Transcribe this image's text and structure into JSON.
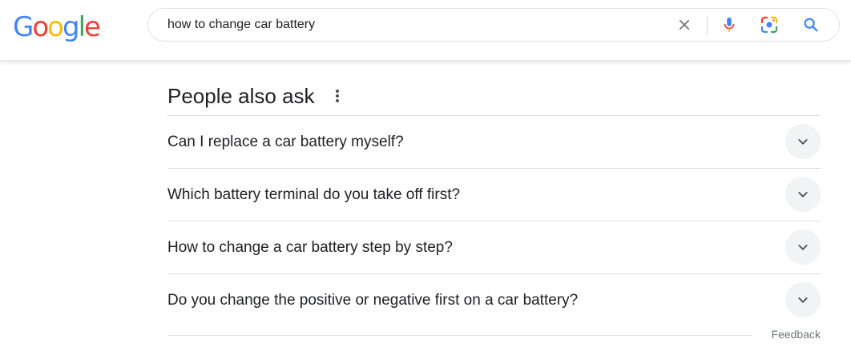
{
  "logo": {
    "letters": [
      "G",
      "o",
      "o",
      "g",
      "l",
      "e"
    ],
    "colors": [
      "#4285F4",
      "#EA4335",
      "#FBBC05",
      "#4285F4",
      "#34A853",
      "#EA4335"
    ]
  },
  "search": {
    "value": "how to change car battery"
  },
  "icons": {
    "clear": "close-icon",
    "voice": "microphone-icon",
    "lens": "camera-lens-icon",
    "search": "search-icon",
    "more": "more-vertical-icon",
    "expand": "chevron-down-icon"
  },
  "paa": {
    "title": "People also ask",
    "questions": [
      "Can I replace a car battery myself?",
      "Which battery terminal do you take off first?",
      "How to change a car battery step by step?",
      "Do you change the positive or negative first on a car battery?"
    ]
  },
  "footer": {
    "feedback": "Feedback"
  }
}
